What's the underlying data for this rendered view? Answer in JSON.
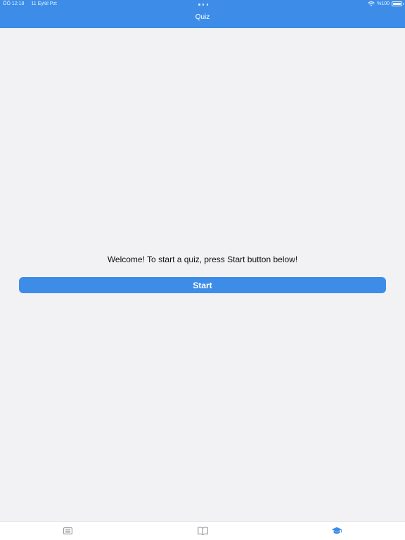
{
  "status_bar": {
    "time": "ÖÖ 12:18",
    "date": "11 Eylül Pzt",
    "battery_text": "%100",
    "icons": [
      "wifi-icon",
      "battery-icon"
    ]
  },
  "nav": {
    "title": "Quiz"
  },
  "main": {
    "welcome_text": "Welcome! To start a quiz, press Start button below!",
    "start_label": "Start"
  },
  "tab_bar": {
    "tabs": [
      {
        "icon": "list-icon",
        "selected": false
      },
      {
        "icon": "book-icon",
        "selected": false
      },
      {
        "icon": "graduation-cap-icon",
        "selected": true
      }
    ]
  },
  "colors": {
    "accent": "#3d8de8",
    "background": "#f2f2f4",
    "tab_inactive": "#8e8e93"
  }
}
